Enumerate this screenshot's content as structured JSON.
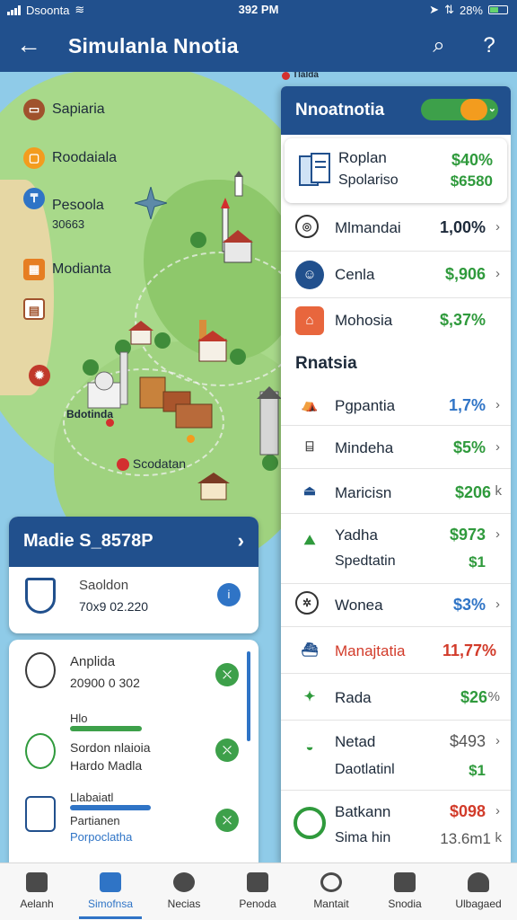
{
  "status": {
    "carrier": "Dsoonta",
    "time": "392 PM",
    "battery": "28%"
  },
  "appbar": {
    "title": "Simulanla Nnotia"
  },
  "map": {
    "labels": [
      {
        "text": "Sapiaria"
      },
      {
        "text": "Roodaiala"
      },
      {
        "text": "Pesoola",
        "sub": "30663"
      },
      {
        "text": "Modianta"
      }
    ],
    "places": [
      "Bdotinda",
      "Scodatan",
      "Tlalda"
    ]
  },
  "summary": {
    "header": "Madie S_8578P",
    "title": "Saoldon",
    "value": "70x9 02.220"
  },
  "left_list": [
    {
      "a": "Anplida",
      "b": "20900 0 302"
    },
    {
      "a": "Hlo",
      "b": "Sordon nlaioia",
      "c": "Hardo Madla"
    },
    {
      "a": "Llabaiatl",
      "b": "Partianen",
      "c": "Porpoclatha"
    }
  ],
  "panel": {
    "title": "Nnoatnotia",
    "top_tile": {
      "name1": "Roplan",
      "name2": "Spolariso",
      "val1": "$40%",
      "val2": "$6580"
    },
    "rows": [
      {
        "name": "Mlmandai",
        "value": "1,00%"
      },
      {
        "name": "Cenla",
        "value": "$,906"
      },
      {
        "name": "Mohosia",
        "value": "$,37%"
      }
    ],
    "section": "Rnatsia",
    "rows2": [
      {
        "name": "Pgpantia",
        "value": "1,7%"
      },
      {
        "name": "Mindeha",
        "value": "$5%"
      },
      {
        "name": "Maricisn",
        "value": "$206",
        "suffix": "k"
      },
      {
        "name": "Yadha",
        "name2": "Spedtatin",
        "value": "$973",
        "value2": "$1"
      },
      {
        "name": "Wonea",
        "value": "$3%"
      },
      {
        "name": "Manajtatia",
        "value": "11,77%"
      },
      {
        "name": "Rada",
        "value": "$26",
        "suffix": "%"
      },
      {
        "name": "Netad",
        "name2": "Daotlatinl",
        "value": "$493",
        "value2": "$1"
      },
      {
        "name": "Batkann",
        "name2": "Sima hin",
        "value": "$098",
        "value2": "13.6m1",
        "suffix2": "k"
      }
    ]
  },
  "nav": [
    "Aelanh",
    "Simofnsa",
    "Necias",
    "Penoda",
    "Mantait",
    "Snodia",
    "Ulbagaed"
  ],
  "colors": {
    "primary": "#21508d",
    "accent": "#2f74c6",
    "positive": "#2f9a3c",
    "negative": "#d23b2a",
    "badge": "#f39c1e"
  }
}
